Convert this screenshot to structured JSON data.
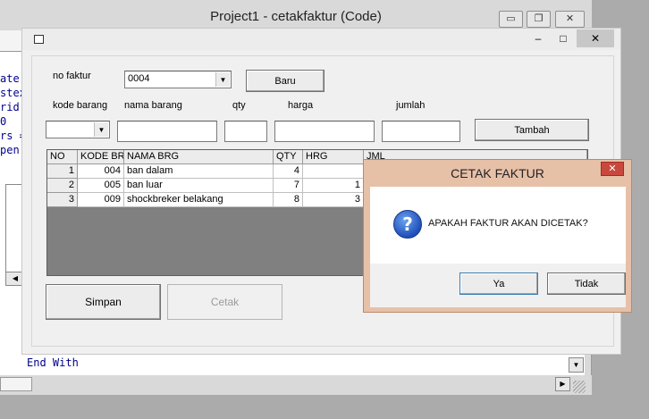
{
  "code_window": {
    "title": "Project1 - cetakfaktur (Code)",
    "minimize": "▭",
    "maximize": "❐",
    "close": "✕",
    "left_fragments": [
      "ate",
      "stex",
      "rid",
      "0",
      "rs =",
      "pen"
    ],
    "bottom_code": "End With"
  },
  "form": {
    "caption_icon": "form-icon",
    "minimize": "‒",
    "maximize": "□",
    "close": "✕",
    "no_faktur_label": "no faktur",
    "no_faktur_value": "0004",
    "baru_button": "Baru",
    "labels": {
      "kode_barang": "kode barang",
      "nama_barang": "nama barang",
      "qty": "qty",
      "harga": "harga",
      "jumlah": "jumlah"
    },
    "tambah_button": "Tambah",
    "grid": {
      "headers": [
        "NO",
        "KODE BR",
        "NAMA BRG",
        "QTY",
        "HRG",
        "JML"
      ],
      "rows": [
        {
          "no": "1",
          "kode": "004",
          "nama": "ban dalam",
          "qty": "4",
          "hrg": "",
          "jml": ""
        },
        {
          "no": "2",
          "kode": "005",
          "nama": "ban luar",
          "qty": "7",
          "hrg": "1",
          "jml": ""
        },
        {
          "no": "3",
          "kode": "009",
          "nama": "shockbreker belakang",
          "qty": "8",
          "hrg": "3",
          "jml": ""
        }
      ]
    },
    "simpan_button": "Simpan",
    "cetak_button": "Cetak"
  },
  "message_box": {
    "title": "CETAK FAKTUR",
    "close": "✕",
    "icon": "question-icon",
    "text": "APAKAH FAKTUR AKAN DICETAK?",
    "yes_button": "Ya",
    "no_button": "Tidak"
  }
}
